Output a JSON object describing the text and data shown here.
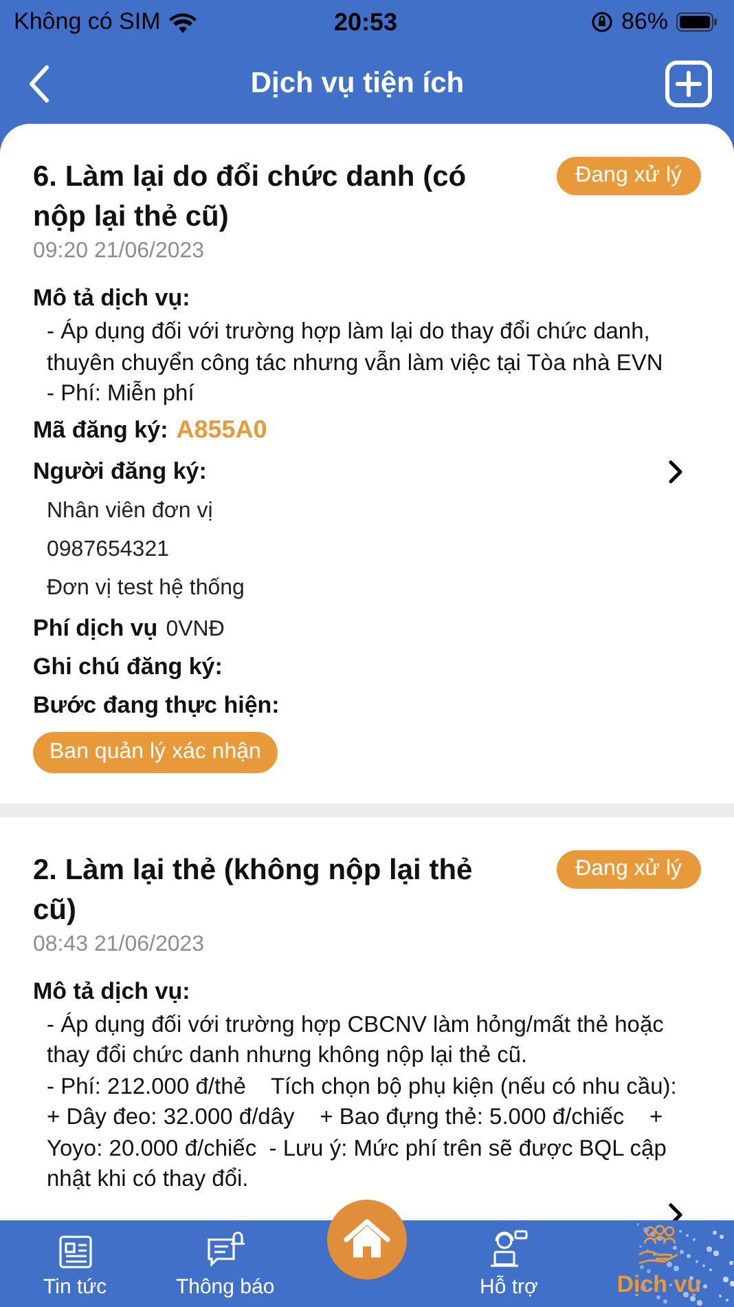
{
  "status_bar": {
    "carrier": "Không có SIM",
    "time": "20:53",
    "battery": "86%"
  },
  "header": {
    "title": "Dịch vụ tiện ích"
  },
  "cards": [
    {
      "title": "6. Làm lại do đổi chức danh (có nộp lại thẻ cũ)",
      "status": "Đang xử lý",
      "time": "09:20 21/06/2023",
      "description_label": "Mô tả dịch vụ:",
      "description": "- Áp dụng đối với trường hợp làm lại do thay đổi chức danh, thuyên chuyển công tác nhưng vẫn làm việc tại Tòa nhà EVN  - Phí: Miễn phí",
      "code_label": "Mã đăng ký:",
      "code": "A855A0",
      "registrant_label": "Người đăng ký:",
      "registrant": [
        "Nhân viên đơn vị",
        "0987654321",
        "Đơn vị test hệ thống"
      ],
      "fee_label": "Phí dịch vụ",
      "fee": "0VNĐ",
      "note_label": "Ghi chú đăng ký:",
      "step_label": "Bước đang thực hiện:",
      "step": "Ban quản lý xác nhận"
    },
    {
      "title": "2. Làm lại thẻ (không nộp lại thẻ cũ)",
      "status": "Đang xử lý",
      "time": "08:43 21/06/2023",
      "description_label": "Mô tả dịch vụ:",
      "description": "- Áp dụng đối với trường hợp CBCNV làm hỏng/mất thẻ hoặc thay đổi chức danh nhưng không nộp lại thẻ cũ.\n- Phí: 212.000 đ/thẻ    Tích chọn bộ phụ kiện (nếu có nhu cầu):    + Dây đeo: 32.000 đ/dây    + Bao đựng thẻ: 5.000 đ/chiếc    + Yoyo: 20.000 đ/chiếc  - Lưu ý: Mức phí trên sẽ được BQL cập nhật khi có thay đổi."
    }
  ],
  "tabs": [
    {
      "label": "Tin tức",
      "kind": "news",
      "selected": false
    },
    {
      "label": "Thông báo",
      "kind": "bell",
      "selected": false
    },
    {
      "kind": "home",
      "selected": false
    },
    {
      "label": "Hỗ trợ",
      "kind": "support",
      "selected": false
    },
    {
      "label": "Dịch vụ",
      "kind": "service",
      "selected": true
    }
  ]
}
